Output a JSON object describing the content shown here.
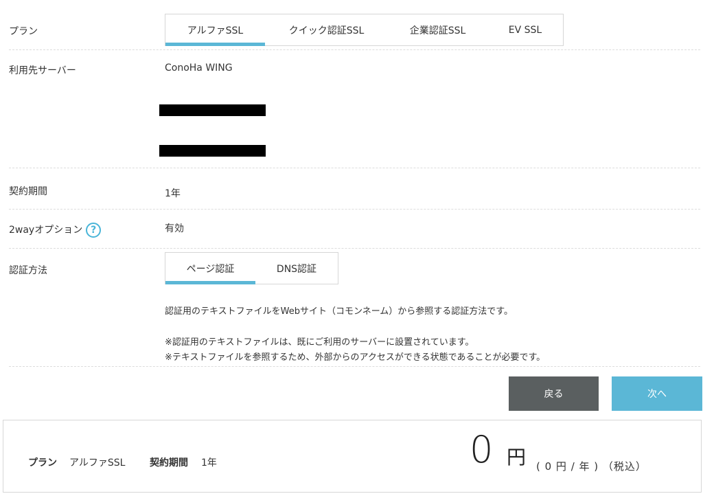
{
  "rows": {
    "plan": {
      "label": "プラン",
      "tabs": [
        "アルファSSL",
        "クイック認証SSL",
        "企業認証SSL",
        "EV SSL"
      ]
    },
    "server": {
      "label": "利用先サーバー",
      "value": "ConoHa WING"
    },
    "term": {
      "label": "契約期間",
      "value": "1年"
    },
    "twoway": {
      "label": "2wayオプション",
      "help_icon": "question-circle-icon",
      "value": "有効"
    },
    "auth": {
      "label": "認証方法",
      "tabs": [
        "ページ認証",
        "DNS認証"
      ],
      "description": "認証用のテキストファイルをWebサイト（コモンネーム）から参照する認証方法です。",
      "notes": [
        "※認証用のテキストファイルは、既にご利用のサーバーに設置されています。",
        "※テキストファイルを参照するため、外部からのアクセスができる状態であることが必要です。"
      ]
    }
  },
  "buttons": {
    "back": "戻る",
    "next": "次へ"
  },
  "summary": {
    "plan_label": "プラン",
    "plan_value": "アルファSSL",
    "term_label": "契約期間",
    "term_value": "1年",
    "price": "0",
    "currency": "円",
    "price_note": "( 0 円 / 年 ) （税込）"
  },
  "colors": {
    "accent": "#5bb7d6",
    "back_button": "#5a5f60",
    "help_icon": "#49b5d8"
  }
}
